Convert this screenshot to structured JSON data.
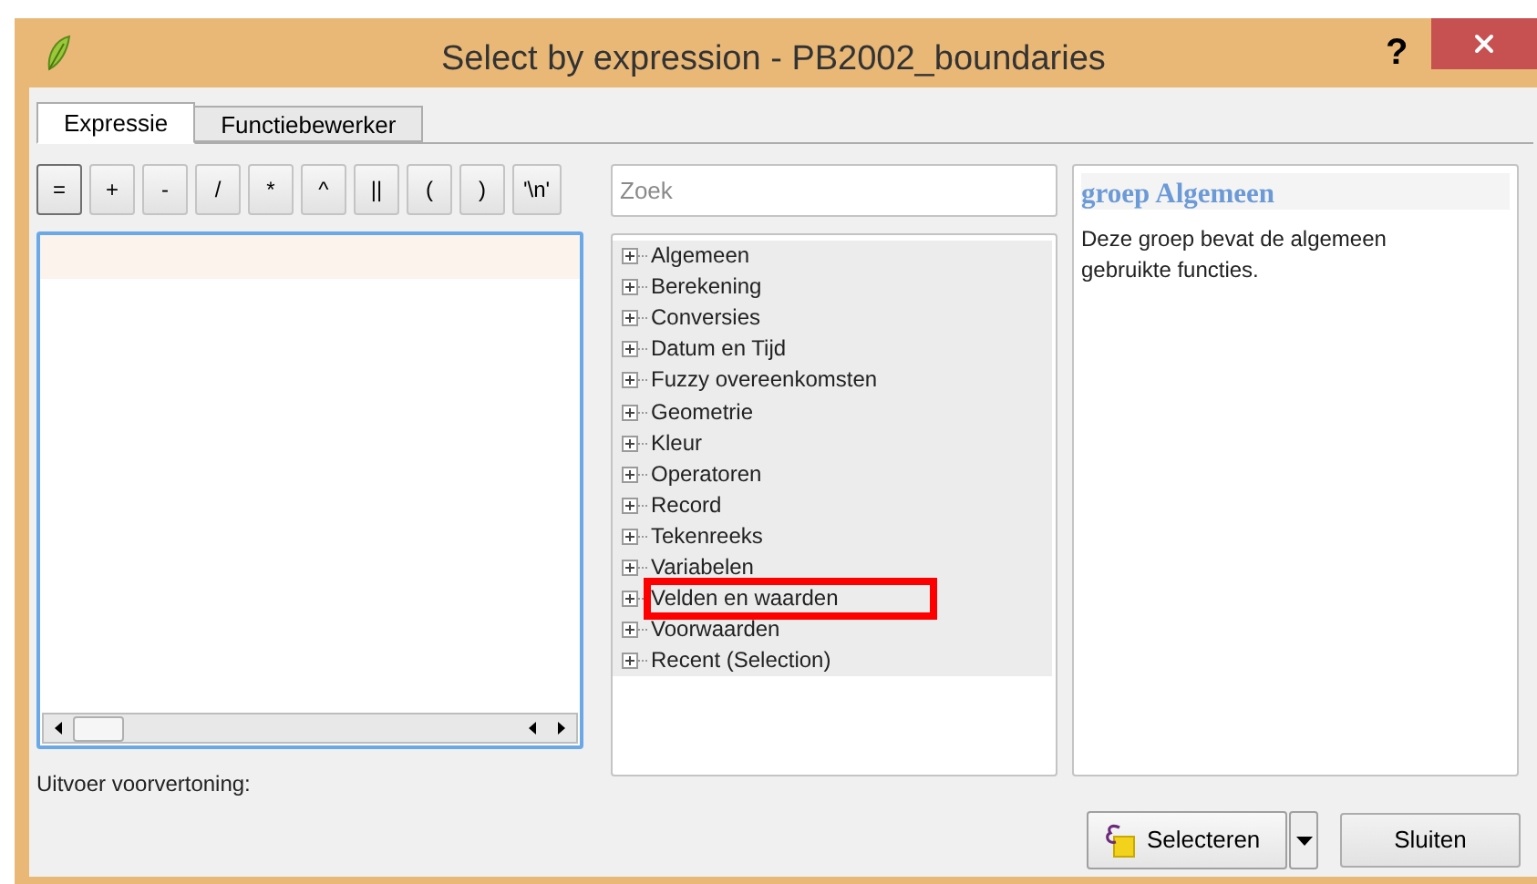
{
  "window": {
    "title": "Select by expression - PB2002_boundaries",
    "help": "?"
  },
  "tabs": [
    {
      "label": "Expressie",
      "selected": true
    },
    {
      "label": "Functiebewerker",
      "selected": false
    }
  ],
  "operators": [
    "=",
    "+",
    "-",
    "/",
    "*",
    "^",
    "||",
    "(",
    ")",
    "'\\n'"
  ],
  "search": {
    "placeholder": "Zoek"
  },
  "functions": [
    {
      "label": "Algemeen",
      "highlighted": false
    },
    {
      "label": "Berekening",
      "highlighted": false
    },
    {
      "label": "Conversies",
      "highlighted": false
    },
    {
      "label": "Datum en Tijd",
      "highlighted": false
    },
    {
      "label": "Fuzzy overeenkomsten",
      "highlighted": false
    },
    {
      "label": "Geometrie",
      "highlighted": false
    },
    {
      "label": "Kleur",
      "highlighted": false
    },
    {
      "label": "Operatoren",
      "highlighted": false
    },
    {
      "label": "Record",
      "highlighted": false
    },
    {
      "label": "Tekenreeks",
      "highlighted": false
    },
    {
      "label": "Variabelen",
      "highlighted": false
    },
    {
      "label": "Velden en waarden",
      "highlighted": true
    },
    {
      "label": "Voorwaarden",
      "highlighted": false
    },
    {
      "label": "Recent (Selection)",
      "highlighted": false
    }
  ],
  "help_panel": {
    "title": "groep Algemeen",
    "text": "Deze groep bevat de algemeen gebruikte functies."
  },
  "output_preview": {
    "label": "Uitvoer voorvertoning:"
  },
  "buttons": {
    "select": "Selecteren",
    "close": "Sluiten"
  }
}
